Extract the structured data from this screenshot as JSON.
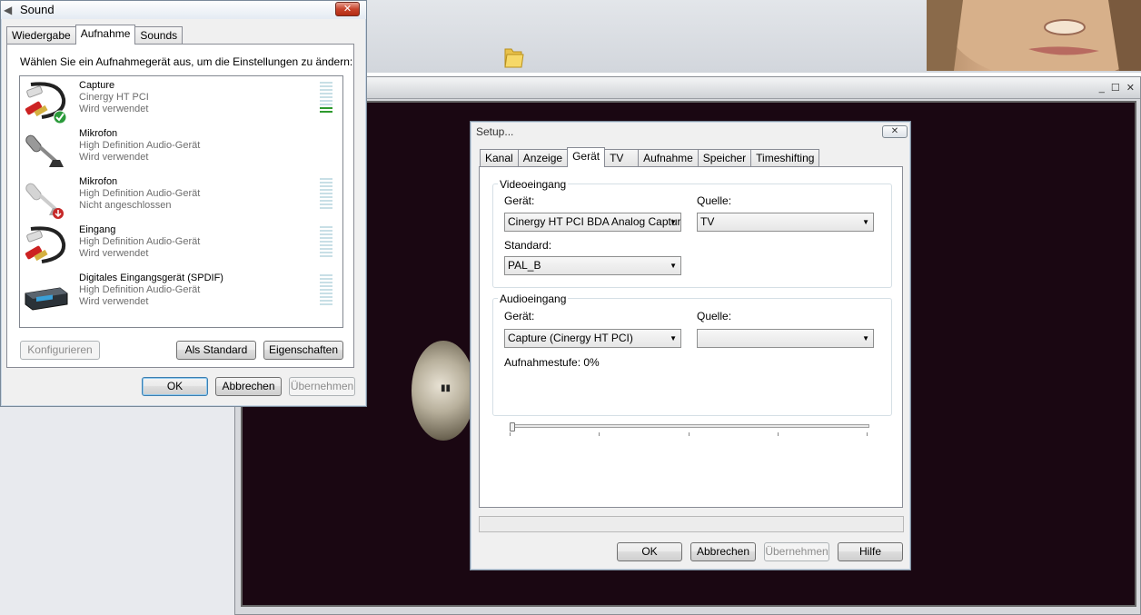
{
  "sound_dialog": {
    "title": "Sound",
    "close_glyph": "✕",
    "tabs": [
      {
        "label": "Wiedergabe"
      },
      {
        "label": "Aufnahme"
      },
      {
        "label": "Sounds"
      }
    ],
    "active_tab": "Aufnahme",
    "instruction": "Wählen Sie ein Aufnahmegerät aus, um die Einstellungen zu ändern:",
    "devices": [
      {
        "name": "Capture",
        "driver": "Cinergy HT PCI",
        "status": "Wird verwendet",
        "icon": "rca-cable-icon",
        "default": true,
        "level_active": 2
      },
      {
        "name": "Mikrofon",
        "driver": "High Definition Audio-Gerät",
        "status": "Wird verwendet",
        "icon": "microphone-icon",
        "default": false,
        "level_active": 0
      },
      {
        "name": "Mikrofon",
        "driver": "High Definition Audio-Gerät",
        "status": "Nicht angeschlossen",
        "icon": "microphone-disconnected-icon",
        "default": false,
        "level_active": 0
      },
      {
        "name": "Eingang",
        "driver": "High Definition Audio-Gerät",
        "status": "Wird verwendet",
        "icon": "rca-cable-icon",
        "default": false,
        "level_active": 0
      },
      {
        "name": "Digitales Eingangsgerät (SPDIF)",
        "driver": "High Definition Audio-Gerät",
        "status": "Wird verwendet",
        "icon": "spdif-device-icon",
        "default": false,
        "level_active": 0
      }
    ],
    "buttons": {
      "configure": "Konfigurieren",
      "set_default": "Als Standard",
      "properties": "Eigenschaften",
      "ok": "OK",
      "cancel": "Abbrechen",
      "apply": "Übernehmen"
    }
  },
  "setup_dialog": {
    "title": "Setup...",
    "close_glyph": "✕",
    "tabs": [
      {
        "label": "Kanal"
      },
      {
        "label": "Anzeige"
      },
      {
        "label": "Gerät"
      },
      {
        "label": "TV"
      },
      {
        "label": "Aufnahme"
      },
      {
        "label": "Speicher"
      },
      {
        "label": "Timeshifting"
      }
    ],
    "active_tab": "Gerät",
    "video_group": {
      "label": "Videoeingang",
      "device_label": "Gerät:",
      "device_value": "Cinergy HT PCI BDA Analog Capture",
      "source_label": "Quelle:",
      "source_value": "TV",
      "standard_label": "Standard:",
      "standard_value": "PAL_B"
    },
    "audio_group": {
      "label": "Audioeingang",
      "device_label": "Gerät:",
      "device_value": "Capture (Cinergy HT PCI)",
      "source_label": "Quelle:",
      "source_value": "",
      "level_label": "Aufnahmestufe: 0%",
      "level_value": 0
    },
    "buttons": {
      "ok": "OK",
      "cancel": "Abbrechen",
      "apply": "Übernehmen",
      "help": "Hilfe"
    }
  },
  "tv_window": {
    "controls": "_ ☐ ✕",
    "play_glyph": "▮▮"
  },
  "colors": {
    "tv_screen": "#1a0712",
    "dialog_bg": "#f0f0f0",
    "meter_active": "#2e9a2e"
  }
}
